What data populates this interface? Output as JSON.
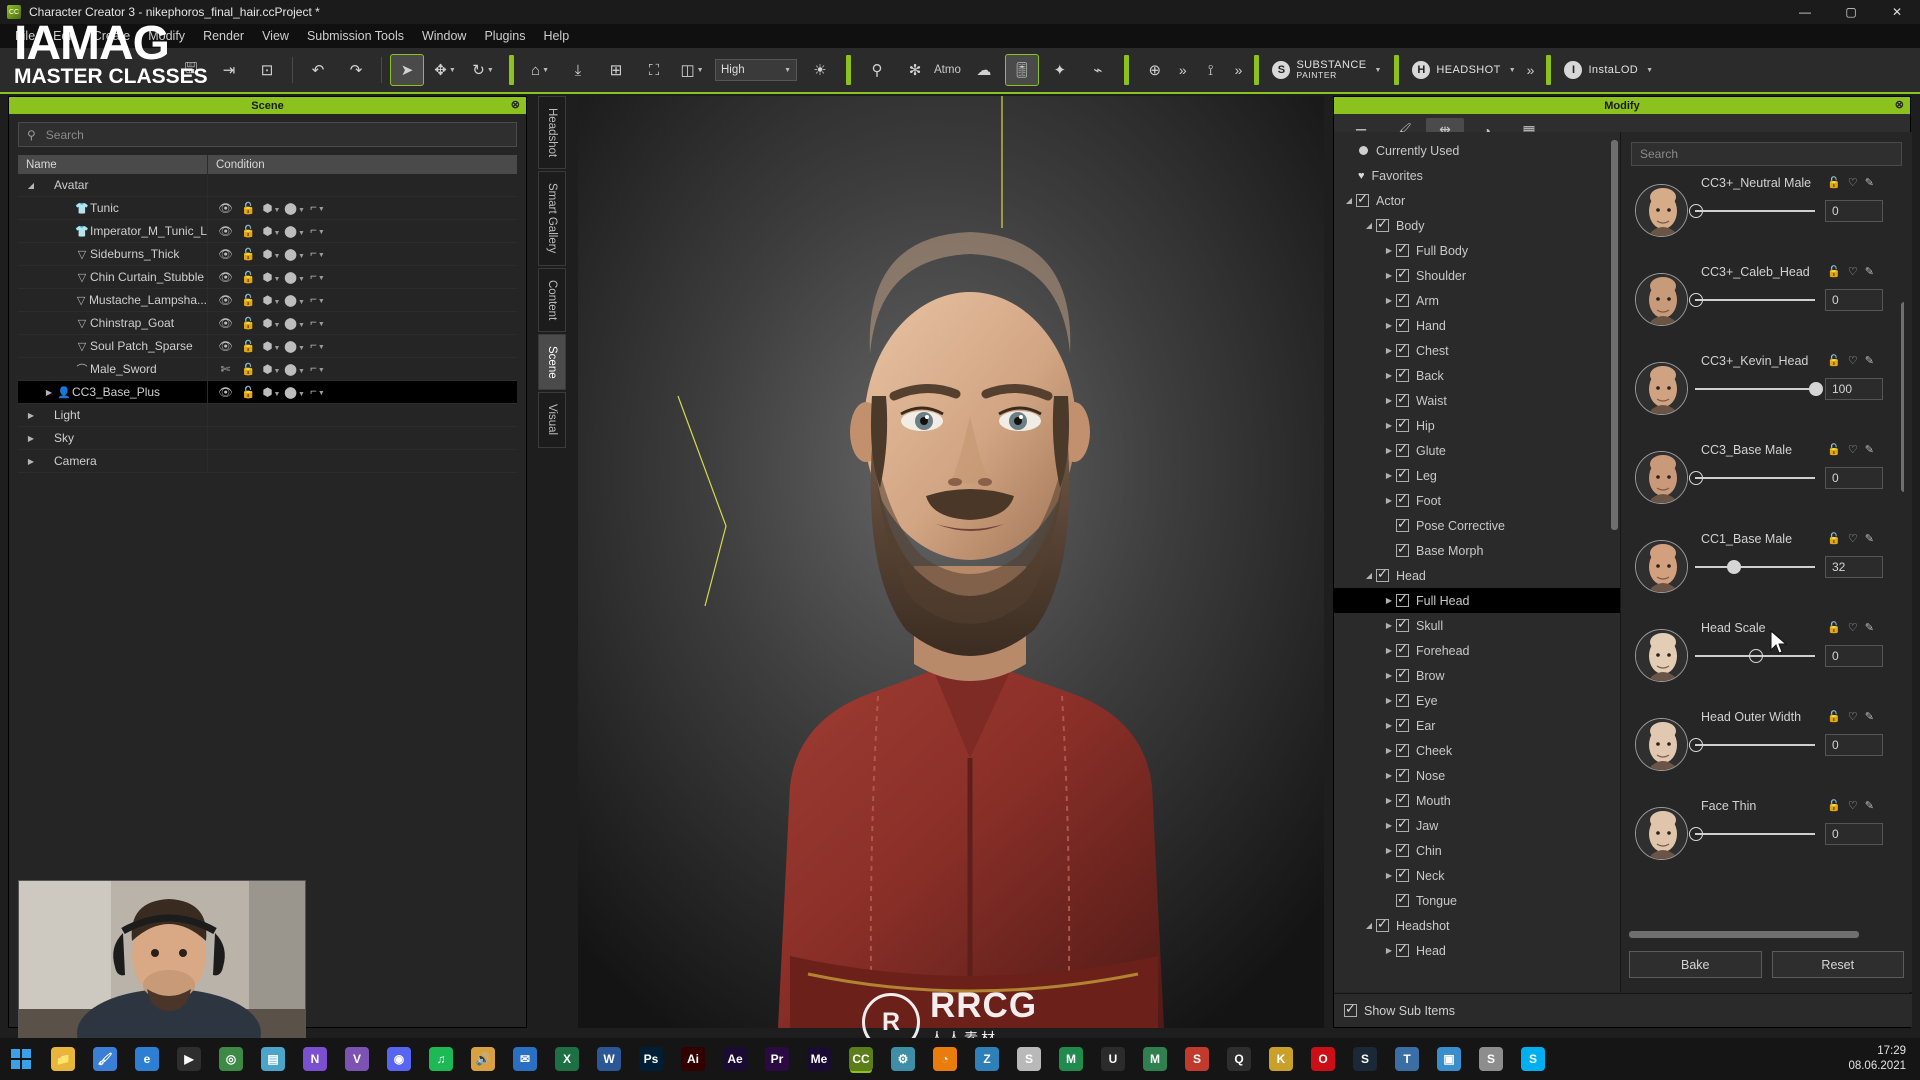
{
  "window": {
    "title": "Character Creator 3 - nikephoros_final_hair.ccProject *",
    "app_icon": "cc3-icon",
    "minimize": "—",
    "maximize": "▢",
    "close": "✕"
  },
  "menu": {
    "items": [
      "File",
      "Edit",
      "Create",
      "Modify",
      "Render",
      "View",
      "Submission Tools",
      "Window",
      "Plugins",
      "Help"
    ]
  },
  "watermark": {
    "line1": "IAMAG",
    "line2": "MASTER CLASSES",
    "center_main": "RRCG",
    "center_sub": "人人素材",
    "center_logo": "R"
  },
  "toolbar": {
    "quality_label": "High",
    "atmosphere_label": "Atmo",
    "chevron": "»",
    "groups": [
      {
        "name": "file",
        "buttons": [
          {
            "icon": "usb-save-icon",
            "glyph": "🖫"
          },
          {
            "icon": "export-icon",
            "glyph": "⇥"
          },
          {
            "icon": "import-icon",
            "glyph": "⊡"
          }
        ]
      },
      {
        "name": "history",
        "buttons": [
          {
            "icon": "undo-icon",
            "glyph": "↶"
          },
          {
            "icon": "redo-icon",
            "glyph": "↷"
          }
        ]
      },
      {
        "name": "transform",
        "buttons": [
          {
            "icon": "select-arrow-icon",
            "glyph": "➤"
          },
          {
            "icon": "move-icon",
            "glyph": "✥"
          },
          {
            "icon": "rotate-icon",
            "glyph": "↻"
          }
        ]
      },
      {
        "name": "view",
        "buttons": [
          {
            "icon": "home-view-icon",
            "glyph": "⌂"
          },
          {
            "icon": "fit-view-icon",
            "glyph": "⤓"
          },
          {
            "icon": "grid-view-icon",
            "glyph": "⊞"
          },
          {
            "icon": "frame-icon",
            "glyph": "⛶"
          },
          {
            "icon": "bounding-box-icon",
            "glyph": "◫"
          }
        ]
      },
      {
        "name": "render",
        "buttons": [
          {
            "icon": "sun-light-icon",
            "glyph": "☀"
          }
        ]
      },
      {
        "name": "effects",
        "buttons": [
          {
            "icon": "pose-icon",
            "glyph": "⚲"
          },
          {
            "icon": "particle-icon",
            "glyph": "✻"
          },
          {
            "icon": "fog-icon",
            "glyph": "☁"
          },
          {
            "icon": "sliders-icon",
            "glyph": "🎚"
          },
          {
            "icon": "wand-icon",
            "glyph": "✦"
          },
          {
            "icon": "graph-icon",
            "glyph": "⌁"
          }
        ]
      },
      {
        "name": "plugins",
        "buttons": [
          {
            "icon": "globe-icon",
            "glyph": "⊕"
          },
          {
            "icon": "target-icon",
            "glyph": "⟟"
          }
        ]
      }
    ],
    "brands": [
      {
        "name": "substance-painter",
        "line1": "SUBSTANCE",
        "line2": "PAINTER",
        "icon": "substance-s-icon"
      },
      {
        "name": "headshot",
        "line1": "HEADSHOT",
        "line2": "",
        "icon": "headshot-icon"
      },
      {
        "name": "instalod",
        "line1": "InstaLOD",
        "line2": "",
        "icon": "instalod-icon"
      }
    ]
  },
  "scene_panel": {
    "title": "Scene",
    "close": "⊗",
    "search_placeholder": "Search",
    "search_value": "",
    "search_icon": "search-icon",
    "columns": [
      "Name",
      "Condition"
    ],
    "rows": [
      {
        "name": "Avatar",
        "indent": 0,
        "arrow": "◢",
        "icon": "",
        "selected": false,
        "has_condition": false
      },
      {
        "name": "Tunic",
        "indent": 2,
        "arrow": "",
        "icon": "shirt-icon",
        "selected": false,
        "has_condition": true,
        "vis": "eye-icon"
      },
      {
        "name": "Imperator_M_Tunic_L",
        "indent": 2,
        "arrow": "",
        "icon": "shirt-icon",
        "selected": false,
        "has_condition": true,
        "vis": "eye-icon"
      },
      {
        "name": "Sideburns_Thick",
        "indent": 2,
        "arrow": "",
        "icon": "beard-icon",
        "selected": false,
        "has_condition": true,
        "vis": "eye-icon"
      },
      {
        "name": "Chin Curtain_Stubble",
        "indent": 2,
        "arrow": "",
        "icon": "beard-icon",
        "selected": false,
        "has_condition": true,
        "vis": "eye-icon"
      },
      {
        "name": "Mustache_Lampsha...",
        "indent": 2,
        "arrow": "",
        "icon": "beard-icon",
        "selected": false,
        "has_condition": true,
        "vis": "eye-icon"
      },
      {
        "name": "Chinstrap_Goat",
        "indent": 2,
        "arrow": "",
        "icon": "beard-icon",
        "selected": false,
        "has_condition": true,
        "vis": "eye-icon"
      },
      {
        "name": "Soul Patch_Sparse",
        "indent": 2,
        "arrow": "",
        "icon": "beard-icon",
        "selected": false,
        "has_condition": true,
        "vis": "eye-icon"
      },
      {
        "name": "Male_Sword",
        "indent": 2,
        "arrow": "",
        "icon": "sword-icon",
        "selected": false,
        "has_condition": true,
        "vis": "eye-closed-icon"
      },
      {
        "name": "CC3_Base_Plus",
        "indent": 1,
        "arrow": "▶",
        "icon": "person-icon",
        "selected": true,
        "has_condition": true,
        "vis": "eye-icon"
      },
      {
        "name": "Light",
        "indent": 0,
        "arrow": "▶",
        "icon": "",
        "selected": false,
        "has_condition": false
      },
      {
        "name": "Sky",
        "indent": 0,
        "arrow": "▶",
        "icon": "",
        "selected": false,
        "has_condition": false
      },
      {
        "name": "Camera",
        "indent": 0,
        "arrow": "▶",
        "icon": "",
        "selected": false,
        "has_condition": false
      }
    ],
    "condition_icons": [
      "visibility-icon",
      "lock-icon",
      "mesh-icon",
      "material-icon",
      "uv-icon"
    ]
  },
  "vertical_tabs": {
    "items": [
      {
        "label": "Headshot",
        "active": false
      },
      {
        "label": "Smart Gallery",
        "active": false
      },
      {
        "label": "Content",
        "active": false
      },
      {
        "label": "Scene",
        "active": true
      },
      {
        "label": "Visual",
        "active": false
      }
    ]
  },
  "modify_panel": {
    "title": "Modify",
    "close": "⊗",
    "tabs": [
      {
        "name": "tab-attribute",
        "icon": "sliders-icon",
        "glyph": "⚌",
        "active": false
      },
      {
        "name": "tab-material",
        "icon": "brush-icon",
        "glyph": "🖌",
        "active": false
      },
      {
        "name": "tab-morph",
        "icon": "morph-icon",
        "glyph": "⇹",
        "active": true
      },
      {
        "name": "tab-physics",
        "icon": "physics-icon",
        "glyph": "◕",
        "active": false
      },
      {
        "name": "tab-texture",
        "icon": "checker-icon",
        "glyph": "▦",
        "active": false
      }
    ],
    "tree": [
      {
        "label": "Currently Used",
        "indent": 0,
        "type": "dot",
        "arrow": "",
        "checked": false,
        "selected": false
      },
      {
        "label": "Favorites",
        "indent": 0,
        "type": "heart",
        "arrow": "",
        "checked": false,
        "selected": false
      },
      {
        "label": "Actor",
        "indent": 0,
        "type": "check",
        "arrow": "◢",
        "checked": true,
        "selected": false
      },
      {
        "label": "Body",
        "indent": 1,
        "type": "check",
        "arrow": "◢",
        "checked": true,
        "selected": false
      },
      {
        "label": "Full Body",
        "indent": 2,
        "type": "check",
        "arrow": "▶",
        "checked": true,
        "selected": false
      },
      {
        "label": "Shoulder",
        "indent": 2,
        "type": "check",
        "arrow": "▶",
        "checked": true,
        "selected": false
      },
      {
        "label": "Arm",
        "indent": 2,
        "type": "check",
        "arrow": "▶",
        "checked": true,
        "selected": false
      },
      {
        "label": "Hand",
        "indent": 2,
        "type": "check",
        "arrow": "▶",
        "checked": true,
        "selected": false
      },
      {
        "label": "Chest",
        "indent": 2,
        "type": "check",
        "arrow": "▶",
        "checked": true,
        "selected": false
      },
      {
        "label": "Back",
        "indent": 2,
        "type": "check",
        "arrow": "▶",
        "checked": true,
        "selected": false
      },
      {
        "label": "Waist",
        "indent": 2,
        "type": "check",
        "arrow": "▶",
        "checked": true,
        "selected": false
      },
      {
        "label": "Hip",
        "indent": 2,
        "type": "check",
        "arrow": "▶",
        "checked": true,
        "selected": false
      },
      {
        "label": "Glute",
        "indent": 2,
        "type": "check",
        "arrow": "▶",
        "checked": true,
        "selected": false
      },
      {
        "label": "Leg",
        "indent": 2,
        "type": "check",
        "arrow": "▶",
        "checked": true,
        "selected": false
      },
      {
        "label": "Foot",
        "indent": 2,
        "type": "check",
        "arrow": "▶",
        "checked": true,
        "selected": false
      },
      {
        "label": "Pose Corrective",
        "indent": 2,
        "type": "check",
        "arrow": "",
        "checked": true,
        "selected": false
      },
      {
        "label": "Base Morph",
        "indent": 2,
        "type": "check",
        "arrow": "",
        "checked": true,
        "selected": false
      },
      {
        "label": "Head",
        "indent": 1,
        "type": "check",
        "arrow": "◢",
        "checked": true,
        "selected": false
      },
      {
        "label": "Full Head",
        "indent": 2,
        "type": "check",
        "arrow": "▶",
        "checked": true,
        "selected": true
      },
      {
        "label": "Skull",
        "indent": 2,
        "type": "check",
        "arrow": "▶",
        "checked": true,
        "selected": false
      },
      {
        "label": "Forehead",
        "indent": 2,
        "type": "check",
        "arrow": "▶",
        "checked": true,
        "selected": false
      },
      {
        "label": "Brow",
        "indent": 2,
        "type": "check",
        "arrow": "▶",
        "checked": true,
        "selected": false
      },
      {
        "label": "Eye",
        "indent": 2,
        "type": "check",
        "arrow": "▶",
        "checked": true,
        "selected": false
      },
      {
        "label": "Ear",
        "indent": 2,
        "type": "check",
        "arrow": "▶",
        "checked": true,
        "selected": false
      },
      {
        "label": "Cheek",
        "indent": 2,
        "type": "check",
        "arrow": "▶",
        "checked": true,
        "selected": false
      },
      {
        "label": "Nose",
        "indent": 2,
        "type": "check",
        "arrow": "▶",
        "checked": true,
        "selected": false
      },
      {
        "label": "Mouth",
        "indent": 2,
        "type": "check",
        "arrow": "▶",
        "checked": true,
        "selected": false
      },
      {
        "label": "Jaw",
        "indent": 2,
        "type": "check",
        "arrow": "▶",
        "checked": true,
        "selected": false
      },
      {
        "label": "Chin",
        "indent": 2,
        "type": "check",
        "arrow": "▶",
        "checked": true,
        "selected": false
      },
      {
        "label": "Neck",
        "indent": 2,
        "type": "check",
        "arrow": "▶",
        "checked": true,
        "selected": false
      },
      {
        "label": "Tongue",
        "indent": 2,
        "type": "check",
        "arrow": "",
        "checked": true,
        "selected": false
      },
      {
        "label": "Headshot",
        "indent": 1,
        "type": "check",
        "arrow": "◢",
        "checked": true,
        "selected": false
      },
      {
        "label": "Head",
        "indent": 2,
        "type": "check",
        "arrow": "▶",
        "checked": true,
        "selected": false
      }
    ],
    "show_sub_items": "Show Sub Items",
    "show_sub_items_checked": true
  },
  "slider_panel": {
    "search_placeholder": "Search",
    "search_value": "",
    "row_icons": [
      "lock-icon",
      "heart-icon",
      "pencil-icon"
    ],
    "sliders": [
      {
        "name": "CC3+_Neutral Male",
        "value": "0",
        "pct": 0,
        "thumb": "head-neutral-male"
      },
      {
        "name": "CC3+_Caleb_Head",
        "value": "0",
        "pct": 0,
        "thumb": "head-caleb"
      },
      {
        "name": "CC3+_Kevin_Head",
        "value": "100",
        "pct": 100,
        "thumb": "head-kevin"
      },
      {
        "name": "CC3_Base Male",
        "value": "0",
        "pct": 0,
        "thumb": "head-cc3-base-male"
      },
      {
        "name": "CC1_Base Male",
        "value": "32",
        "pct": 32,
        "thumb": "head-cc1-base-male"
      },
      {
        "name": "Head Scale",
        "value": "0",
        "pct": 50,
        "thumb": "head-scale"
      },
      {
        "name": "Head Outer Width",
        "value": "0",
        "pct": 0,
        "thumb": "head-outer-width"
      },
      {
        "name": "Face Thin",
        "value": "0",
        "pct": 0,
        "thumb": "head-face-thin"
      }
    ],
    "bake_label": "Bake",
    "reset_label": "Reset"
  },
  "taskbar": {
    "start_icon": "windows-start-icon",
    "items": [
      {
        "name": "file-explorer",
        "glyph": "📁",
        "color": "#e8b63a",
        "active": false
      },
      {
        "name": "paint",
        "glyph": "🖌",
        "color": "#3a7fd5",
        "active": false
      },
      {
        "name": "edge-browser",
        "glyph": "e",
        "color": "#2d7fd3",
        "active": false
      },
      {
        "name": "media-player",
        "glyph": "▶",
        "color": "#2e2e2e",
        "active": false
      },
      {
        "name": "chrome-browser",
        "glyph": "◎",
        "color": "#3d8a46",
        "active": false
      },
      {
        "name": "calculator",
        "glyph": "▤",
        "color": "#4aa5c9",
        "active": false
      },
      {
        "name": "notes-app",
        "glyph": "N",
        "color": "#7a4fd0",
        "active": false
      },
      {
        "name": "viber",
        "glyph": "V",
        "color": "#7c52b3",
        "active": false
      },
      {
        "name": "discord",
        "glyph": "◉",
        "color": "#5865f2",
        "active": false
      },
      {
        "name": "spotify",
        "glyph": "♫",
        "color": "#1db954",
        "active": false
      },
      {
        "name": "sound-app",
        "glyph": "🔊",
        "color": "#d8a040",
        "active": false
      },
      {
        "name": "outlook",
        "glyph": "✉",
        "color": "#2b6fc2",
        "active": false
      },
      {
        "name": "excel",
        "glyph": "X",
        "color": "#1d7044",
        "active": false
      },
      {
        "name": "word",
        "glyph": "W",
        "color": "#2b5797",
        "active": false
      },
      {
        "name": "photoshop",
        "glyph": "Ps",
        "color": "#001e36",
        "active": false
      },
      {
        "name": "illustrator",
        "glyph": "Ai",
        "color": "#330000",
        "active": false
      },
      {
        "name": "after-effects",
        "glyph": "Ae",
        "color": "#1a0b33",
        "active": false
      },
      {
        "name": "premiere-pro",
        "glyph": "Pr",
        "color": "#2a0a40",
        "active": false
      },
      {
        "name": "media-encoder",
        "glyph": "Me",
        "color": "#1a0b33",
        "active": false
      },
      {
        "name": "character-creator",
        "glyph": "CC",
        "color": "#5b7d1a",
        "active": true
      },
      {
        "name": "settings-gear",
        "glyph": "⚙",
        "color": "#3f8ea8",
        "active": false
      },
      {
        "name": "blender",
        "glyph": "◔",
        "color": "#e87d0d",
        "active": false
      },
      {
        "name": "zbrush",
        "glyph": "Z",
        "color": "#2f7fb8",
        "active": false
      },
      {
        "name": "substance",
        "glyph": "S",
        "color": "#b9b9b9",
        "active": false
      },
      {
        "name": "marvelous",
        "glyph": "M",
        "color": "#1f8b4c",
        "active": false
      },
      {
        "name": "unity",
        "glyph": "U",
        "color": "#2b2b2b",
        "active": false
      },
      {
        "name": "maya",
        "glyph": "M",
        "color": "#2f7f4f",
        "active": false
      },
      {
        "name": "sculptris",
        "glyph": "S",
        "color": "#c13a2e",
        "active": false
      },
      {
        "name": "quixel",
        "glyph": "Q",
        "color": "#2e2e2e",
        "active": false
      },
      {
        "name": "keyshot",
        "glyph": "K",
        "color": "#c8a02a",
        "active": false
      },
      {
        "name": "opera",
        "glyph": "O",
        "color": "#cc0f16",
        "active": false
      },
      {
        "name": "steam",
        "glyph": "S",
        "color": "#1b2838",
        "active": false
      },
      {
        "name": "marmoset",
        "glyph": "T",
        "color": "#3b6ea5",
        "active": false
      },
      {
        "name": "photos",
        "glyph": "▣",
        "color": "#3a8ecb",
        "active": false
      },
      {
        "name": "substance-2",
        "glyph": "S",
        "color": "#8d8d8d",
        "active": false
      },
      {
        "name": "skype",
        "glyph": "S",
        "color": "#00aff0",
        "active": false
      }
    ],
    "time": "17:29",
    "date": "08.06.2021"
  }
}
